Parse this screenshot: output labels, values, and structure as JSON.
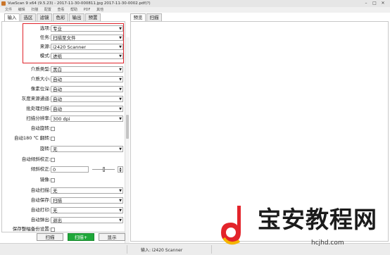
{
  "window": {
    "title": "VueScan 9 x64 (9.5.23) - 2017-11-30-000811.jpg 2017-11-30-0002.pdf(?)",
    "controls": [
      "–",
      "□",
      "✕"
    ]
  },
  "menubar": [
    "文件",
    "编辑",
    "扫描",
    "配置",
    "查看",
    "帮助",
    "PDF",
    "其他"
  ],
  "tabs": {
    "left": [
      "输入",
      "选区",
      "滤镜",
      "色彩",
      "输出",
      "预置"
    ],
    "right": [
      "预览",
      "扫描"
    ],
    "active_left": "输入",
    "active_right": "预览"
  },
  "settings": [
    {
      "key": "mode",
      "label": "选项:",
      "type": "dropdown",
      "value": "专业"
    },
    {
      "key": "task",
      "label": "任务:",
      "type": "dropdown",
      "value": "扫描至文件"
    },
    {
      "key": "source",
      "label": "来源:",
      "type": "dropdown",
      "value": "i2420 Scanner"
    },
    {
      "key": "scan_mode",
      "label": "模式:",
      "type": "dropdown",
      "value": "进纸"
    },
    {
      "key": "media",
      "label": "介质类型:",
      "type": "dropdown",
      "value": "黑白"
    },
    {
      "key": "media_size",
      "label": "介质大小:",
      "type": "dropdown",
      "value": "自动"
    },
    {
      "key": "bit_depth",
      "label": "像素位深:",
      "type": "dropdown",
      "value": "自动"
    },
    {
      "key": "gray_channel",
      "label": "灰度来源通道:",
      "type": "dropdown",
      "value": "自动"
    },
    {
      "key": "batch",
      "label": "批处理扫描:",
      "type": "dropdown",
      "value": "自动"
    },
    {
      "key": "resolution",
      "label": "扫描分辨率:",
      "type": "dropdown",
      "value": "300 dpi"
    },
    {
      "key": "auto_rotate",
      "label": "自动旋转:",
      "type": "checkbox"
    },
    {
      "key": "auto_180",
      "label": "自动180 ℃ 翻转:",
      "type": "checkbox"
    },
    {
      "key": "rotation",
      "label": "旋转:",
      "type": "dropdown",
      "value": "无"
    },
    {
      "key": "auto_deskew",
      "label": "自动倾斜校正:",
      "type": "checkbox"
    },
    {
      "key": "deskew",
      "label": "倾斜校正:",
      "type": "number",
      "value": "0"
    },
    {
      "key": "mirror",
      "label": "镜像:",
      "type": "checkbox"
    },
    {
      "key": "auto_scan",
      "label": "自动扫描:",
      "type": "dropdown",
      "value": "无"
    },
    {
      "key": "auto_save",
      "label": "自动保存:",
      "type": "dropdown",
      "value": "扫描"
    },
    {
      "key": "auto_print",
      "label": "自动打印:",
      "type": "dropdown",
      "value": "无"
    },
    {
      "key": "auto_eject",
      "label": "自动弹出:",
      "type": "dropdown",
      "value": "退出"
    },
    {
      "key": "keep_uncropped",
      "label": "保存整幅备份设置:",
      "type": "checkbox"
    }
  ],
  "buttons": {
    "scan": "扫描",
    "scan_plus": "扫描+",
    "show": "显示"
  },
  "status": {
    "text": "输入: i2420 Scanner"
  },
  "watermark": {
    "title": "宝安教程网",
    "url": "hcjhd.com"
  },
  "colors": {
    "highlight": "#e0222a",
    "scan_plus_bg": "#1fa83a",
    "logo_red": "#e3242b",
    "logo_yellow": "#f5b400"
  }
}
